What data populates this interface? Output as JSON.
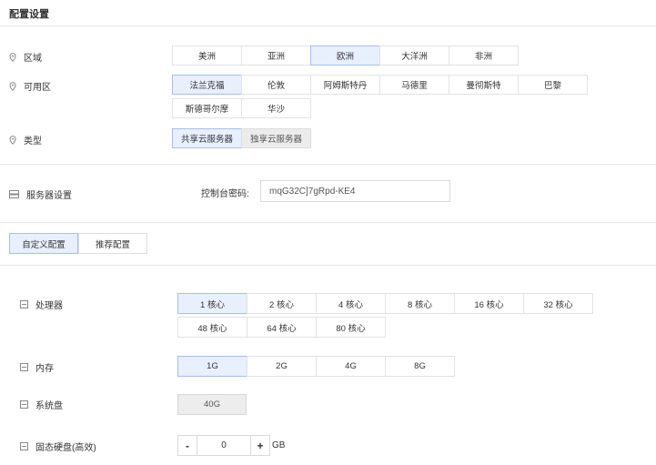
{
  "page": {
    "title": "配置设置"
  },
  "region": {
    "label": "区域",
    "options": [
      "美洲",
      "亚洲",
      "欧洲",
      "大洋洲",
      "非洲"
    ],
    "selected": "欧洲"
  },
  "zone": {
    "label": "可用区",
    "options": [
      "法兰克福",
      "伦敦",
      "阿姆斯特丹",
      "马德里",
      "曼彻斯特",
      "巴黎",
      "斯德哥尔摩",
      "华沙"
    ],
    "selected": "法兰克福"
  },
  "type": {
    "label": "类型",
    "options": [
      "共享云服务器",
      "独享云服务器"
    ],
    "selected": "共享云服务器"
  },
  "server": {
    "label": "服务器设置",
    "password_label": "控制台密码:",
    "password_value": "mqG32C]7gRpd-KE4"
  },
  "tabs": {
    "items": [
      "自定义配置",
      "推荐配置"
    ],
    "selected": "自定义配置"
  },
  "cpu": {
    "label": "处理器",
    "options": [
      "1 核心",
      "2 核心",
      "4 核心",
      "8 核心",
      "16 核心",
      "32 核心",
      "48 核心",
      "64 核心",
      "80 核心"
    ],
    "selected": "1 核心"
  },
  "memory": {
    "label": "内存",
    "options": [
      "1G",
      "2G",
      "4G",
      "8G"
    ],
    "selected": "1G"
  },
  "system_disk": {
    "label": "系统盘",
    "value": "40G"
  },
  "ssd": {
    "label": "固态硬盘(高效)",
    "minus": "-",
    "value": "0",
    "plus": "+",
    "unit": "GB"
  }
}
